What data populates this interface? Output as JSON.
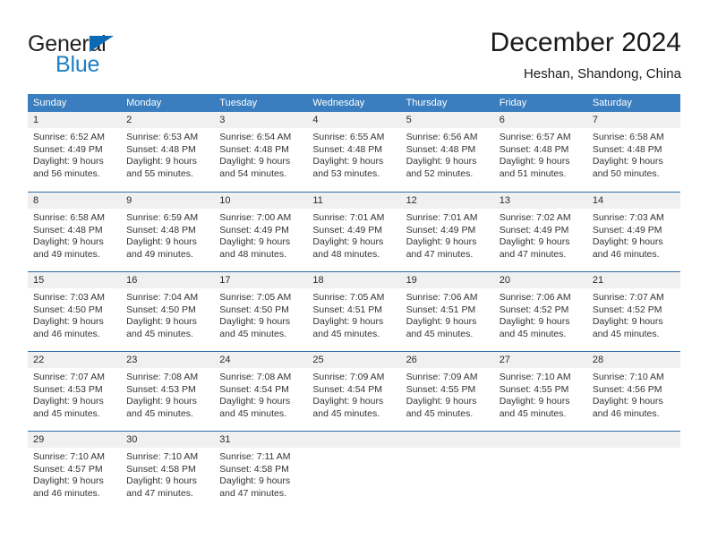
{
  "brand": {
    "name_part1": "General",
    "name_part2": "Blue",
    "color_dark": "#231f20",
    "color_blue": "#1f7fc4"
  },
  "header": {
    "title": "December 2024",
    "subtitle": "Heshan, Shandong, China"
  },
  "theme": {
    "header_bg": "#3a7ebf",
    "header_text": "#ffffff",
    "daynum_bg": "#f0f0f0",
    "row_divider": "#2f6da8",
    "body_text": "#333333"
  },
  "weekday_headers": [
    "Sunday",
    "Monday",
    "Tuesday",
    "Wednesday",
    "Thursday",
    "Friday",
    "Saturday"
  ],
  "weeks": [
    [
      {
        "day": "1",
        "sunrise": "Sunrise: 6:52 AM",
        "sunset": "Sunset: 4:49 PM",
        "daylight1": "Daylight: 9 hours",
        "daylight2": "and 56 minutes."
      },
      {
        "day": "2",
        "sunrise": "Sunrise: 6:53 AM",
        "sunset": "Sunset: 4:48 PM",
        "daylight1": "Daylight: 9 hours",
        "daylight2": "and 55 minutes."
      },
      {
        "day": "3",
        "sunrise": "Sunrise: 6:54 AM",
        "sunset": "Sunset: 4:48 PM",
        "daylight1": "Daylight: 9 hours",
        "daylight2": "and 54 minutes."
      },
      {
        "day": "4",
        "sunrise": "Sunrise: 6:55 AM",
        "sunset": "Sunset: 4:48 PM",
        "daylight1": "Daylight: 9 hours",
        "daylight2": "and 53 minutes."
      },
      {
        "day": "5",
        "sunrise": "Sunrise: 6:56 AM",
        "sunset": "Sunset: 4:48 PM",
        "daylight1": "Daylight: 9 hours",
        "daylight2": "and 52 minutes."
      },
      {
        "day": "6",
        "sunrise": "Sunrise: 6:57 AM",
        "sunset": "Sunset: 4:48 PM",
        "daylight1": "Daylight: 9 hours",
        "daylight2": "and 51 minutes."
      },
      {
        "day": "7",
        "sunrise": "Sunrise: 6:58 AM",
        "sunset": "Sunset: 4:48 PM",
        "daylight1": "Daylight: 9 hours",
        "daylight2": "and 50 minutes."
      }
    ],
    [
      {
        "day": "8",
        "sunrise": "Sunrise: 6:58 AM",
        "sunset": "Sunset: 4:48 PM",
        "daylight1": "Daylight: 9 hours",
        "daylight2": "and 49 minutes."
      },
      {
        "day": "9",
        "sunrise": "Sunrise: 6:59 AM",
        "sunset": "Sunset: 4:48 PM",
        "daylight1": "Daylight: 9 hours",
        "daylight2": "and 49 minutes."
      },
      {
        "day": "10",
        "sunrise": "Sunrise: 7:00 AM",
        "sunset": "Sunset: 4:49 PM",
        "daylight1": "Daylight: 9 hours",
        "daylight2": "and 48 minutes."
      },
      {
        "day": "11",
        "sunrise": "Sunrise: 7:01 AM",
        "sunset": "Sunset: 4:49 PM",
        "daylight1": "Daylight: 9 hours",
        "daylight2": "and 48 minutes."
      },
      {
        "day": "12",
        "sunrise": "Sunrise: 7:01 AM",
        "sunset": "Sunset: 4:49 PM",
        "daylight1": "Daylight: 9 hours",
        "daylight2": "and 47 minutes."
      },
      {
        "day": "13",
        "sunrise": "Sunrise: 7:02 AM",
        "sunset": "Sunset: 4:49 PM",
        "daylight1": "Daylight: 9 hours",
        "daylight2": "and 47 minutes."
      },
      {
        "day": "14",
        "sunrise": "Sunrise: 7:03 AM",
        "sunset": "Sunset: 4:49 PM",
        "daylight1": "Daylight: 9 hours",
        "daylight2": "and 46 minutes."
      }
    ],
    [
      {
        "day": "15",
        "sunrise": "Sunrise: 7:03 AM",
        "sunset": "Sunset: 4:50 PM",
        "daylight1": "Daylight: 9 hours",
        "daylight2": "and 46 minutes."
      },
      {
        "day": "16",
        "sunrise": "Sunrise: 7:04 AM",
        "sunset": "Sunset: 4:50 PM",
        "daylight1": "Daylight: 9 hours",
        "daylight2": "and 45 minutes."
      },
      {
        "day": "17",
        "sunrise": "Sunrise: 7:05 AM",
        "sunset": "Sunset: 4:50 PM",
        "daylight1": "Daylight: 9 hours",
        "daylight2": "and 45 minutes."
      },
      {
        "day": "18",
        "sunrise": "Sunrise: 7:05 AM",
        "sunset": "Sunset: 4:51 PM",
        "daylight1": "Daylight: 9 hours",
        "daylight2": "and 45 minutes."
      },
      {
        "day": "19",
        "sunrise": "Sunrise: 7:06 AM",
        "sunset": "Sunset: 4:51 PM",
        "daylight1": "Daylight: 9 hours",
        "daylight2": "and 45 minutes."
      },
      {
        "day": "20",
        "sunrise": "Sunrise: 7:06 AM",
        "sunset": "Sunset: 4:52 PM",
        "daylight1": "Daylight: 9 hours",
        "daylight2": "and 45 minutes."
      },
      {
        "day": "21",
        "sunrise": "Sunrise: 7:07 AM",
        "sunset": "Sunset: 4:52 PM",
        "daylight1": "Daylight: 9 hours",
        "daylight2": "and 45 minutes."
      }
    ],
    [
      {
        "day": "22",
        "sunrise": "Sunrise: 7:07 AM",
        "sunset": "Sunset: 4:53 PM",
        "daylight1": "Daylight: 9 hours",
        "daylight2": "and 45 minutes."
      },
      {
        "day": "23",
        "sunrise": "Sunrise: 7:08 AM",
        "sunset": "Sunset: 4:53 PM",
        "daylight1": "Daylight: 9 hours",
        "daylight2": "and 45 minutes."
      },
      {
        "day": "24",
        "sunrise": "Sunrise: 7:08 AM",
        "sunset": "Sunset: 4:54 PM",
        "daylight1": "Daylight: 9 hours",
        "daylight2": "and 45 minutes."
      },
      {
        "day": "25",
        "sunrise": "Sunrise: 7:09 AM",
        "sunset": "Sunset: 4:54 PM",
        "daylight1": "Daylight: 9 hours",
        "daylight2": "and 45 minutes."
      },
      {
        "day": "26",
        "sunrise": "Sunrise: 7:09 AM",
        "sunset": "Sunset: 4:55 PM",
        "daylight1": "Daylight: 9 hours",
        "daylight2": "and 45 minutes."
      },
      {
        "day": "27",
        "sunrise": "Sunrise: 7:10 AM",
        "sunset": "Sunset: 4:55 PM",
        "daylight1": "Daylight: 9 hours",
        "daylight2": "and 45 minutes."
      },
      {
        "day": "28",
        "sunrise": "Sunrise: 7:10 AM",
        "sunset": "Sunset: 4:56 PM",
        "daylight1": "Daylight: 9 hours",
        "daylight2": "and 46 minutes."
      }
    ],
    [
      {
        "day": "29",
        "sunrise": "Sunrise: 7:10 AM",
        "sunset": "Sunset: 4:57 PM",
        "daylight1": "Daylight: 9 hours",
        "daylight2": "and 46 minutes."
      },
      {
        "day": "30",
        "sunrise": "Sunrise: 7:10 AM",
        "sunset": "Sunset: 4:58 PM",
        "daylight1": "Daylight: 9 hours",
        "daylight2": "and 47 minutes."
      },
      {
        "day": "31",
        "sunrise": "Sunrise: 7:11 AM",
        "sunset": "Sunset: 4:58 PM",
        "daylight1": "Daylight: 9 hours",
        "daylight2": "and 47 minutes."
      },
      {
        "day": "",
        "sunrise": "",
        "sunset": "",
        "daylight1": "",
        "daylight2": ""
      },
      {
        "day": "",
        "sunrise": "",
        "sunset": "",
        "daylight1": "",
        "daylight2": ""
      },
      {
        "day": "",
        "sunrise": "",
        "sunset": "",
        "daylight1": "",
        "daylight2": ""
      },
      {
        "day": "",
        "sunrise": "",
        "sunset": "",
        "daylight1": "",
        "daylight2": ""
      }
    ]
  ]
}
